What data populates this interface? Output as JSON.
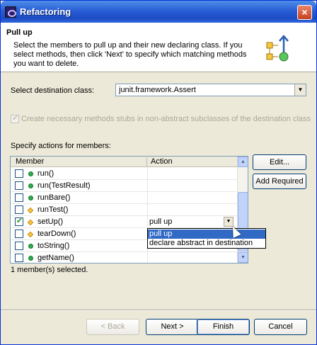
{
  "window": {
    "title": "Refactoring",
    "close_label": "×"
  },
  "header": {
    "title": "Pull up",
    "description": "Select the members to pull up and their new declaring class. If you select methods, then click 'Next' to specify which matching methods you want to delete."
  },
  "destination": {
    "label": "Select destination class:",
    "value": "junit.framework.Assert"
  },
  "stubs_option": {
    "label": "Create necessary methods stubs in non-abstract subclasses of the destination class",
    "checked": true,
    "enabled": false
  },
  "members": {
    "section_label": "Specify actions for members:",
    "columns": [
      "Member",
      "Action"
    ],
    "rows": [
      {
        "name": "run()",
        "visibility": "public",
        "checked": false,
        "action": ""
      },
      {
        "name": "run(TestResult)",
        "visibility": "public",
        "checked": false,
        "action": ""
      },
      {
        "name": "runBare()",
        "visibility": "public",
        "checked": false,
        "action": ""
      },
      {
        "name": "runTest()",
        "visibility": "protected",
        "checked": false,
        "action": ""
      },
      {
        "name": "setUp()",
        "visibility": "protected",
        "checked": true,
        "action": "pull up"
      },
      {
        "name": "tearDown()",
        "visibility": "protected",
        "checked": false,
        "action": ""
      },
      {
        "name": "toString()",
        "visibility": "public",
        "checked": false,
        "action": ""
      },
      {
        "name": "getName()",
        "visibility": "public",
        "checked": false,
        "action": ""
      }
    ],
    "action_options": [
      "pull up",
      "declare abstract in destination"
    ],
    "selected_option": "pull up"
  },
  "side_buttons": {
    "edit": "Edit...",
    "add_required": "Add Required"
  },
  "status_text": "1 member(s) selected.",
  "footer": {
    "back": "< Back",
    "next": "Next >",
    "finish": "Finish",
    "cancel": "Cancel"
  }
}
